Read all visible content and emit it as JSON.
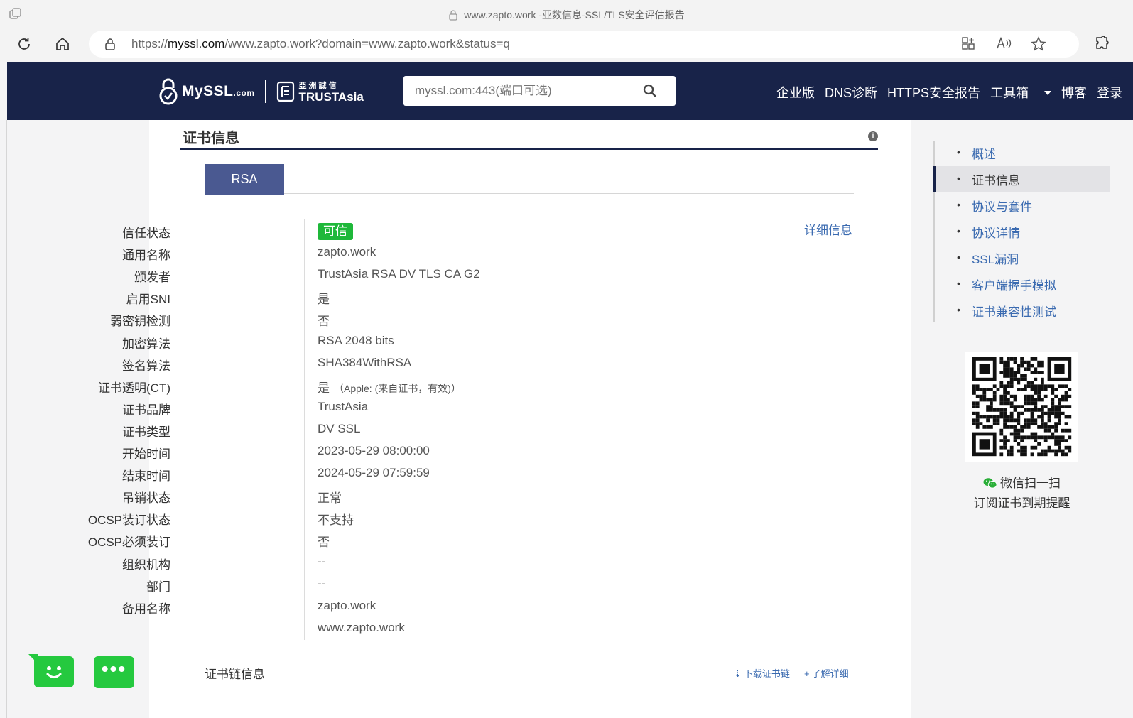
{
  "browser": {
    "tab_title": "www.zapto.work -亚数信息-SSL/TLS安全评估报告",
    "url_prefix": "https://",
    "url_host": "myssl.com",
    "url_rest": "/www.zapto.work?domain=www.zapto.work&status=q"
  },
  "header": {
    "brand": "MySSL",
    "brand_suffix": ".com",
    "partner_cn": "亞洲誠信",
    "partner_en": "TRUSTAsia",
    "search_placeholder": "myssl.com:443(端口可选)",
    "nav": [
      "企业版",
      "DNS诊断",
      "HTTPS安全报告",
      "工具箱",
      "博客",
      "登录"
    ]
  },
  "section": {
    "title": "证书信息",
    "tab": "RSA",
    "detail_link": "详细信息",
    "rows": [
      {
        "label": "信任状态",
        "value": "可信",
        "badge": true
      },
      {
        "label": "通用名称",
        "value": "zapto.work"
      },
      {
        "label": "颁发者",
        "value": "TrustAsia RSA DV TLS CA G2"
      },
      {
        "label": "启用SNI",
        "value": "是"
      },
      {
        "label": "弱密钥检测",
        "value": "否"
      },
      {
        "label": "加密算法",
        "value": "RSA 2048 bits"
      },
      {
        "label": "签名算法",
        "value": "SHA384WithRSA"
      },
      {
        "label": "证书透明(CT)",
        "value": "是",
        "note": "（Apple: (来自证书，有效)）"
      },
      {
        "label": "证书品牌",
        "value": "TrustAsia"
      },
      {
        "label": "证书类型",
        "value": "DV SSL"
      },
      {
        "label": "开始时间",
        "value": "2023-05-29 08:00:00"
      },
      {
        "label": "结束时间",
        "value": "2024-05-29 07:59:59"
      },
      {
        "label": "吊销状态",
        "value": "正常"
      },
      {
        "label": "OCSP装订状态",
        "value": "不支持"
      },
      {
        "label": "OCSP必须装订",
        "value": "否"
      },
      {
        "label": "组织机构",
        "value": "--"
      },
      {
        "label": "部门",
        "value": "--"
      },
      {
        "label": "备用名称",
        "value": "zapto.work"
      },
      {
        "label": "",
        "value": "www.zapto.work"
      }
    ],
    "chain_title": "证书链信息",
    "chain_download": "下载证书链",
    "chain_learn": "了解详细"
  },
  "sidebar": {
    "items": [
      "概述",
      "证书信息",
      "协议与套件",
      "协议详情",
      "SSL漏洞",
      "客户端握手模拟",
      "证书兼容性测试"
    ],
    "active_index": 1,
    "qr_caption1": "微信扫一扫",
    "qr_caption2": "订阅证书到期提醒"
  },
  "colors": {
    "header_bg": "#182349",
    "accent": "#4a5991",
    "link": "#3a6ab0",
    "success": "#1fb83a",
    "fab": "#25c93f"
  }
}
